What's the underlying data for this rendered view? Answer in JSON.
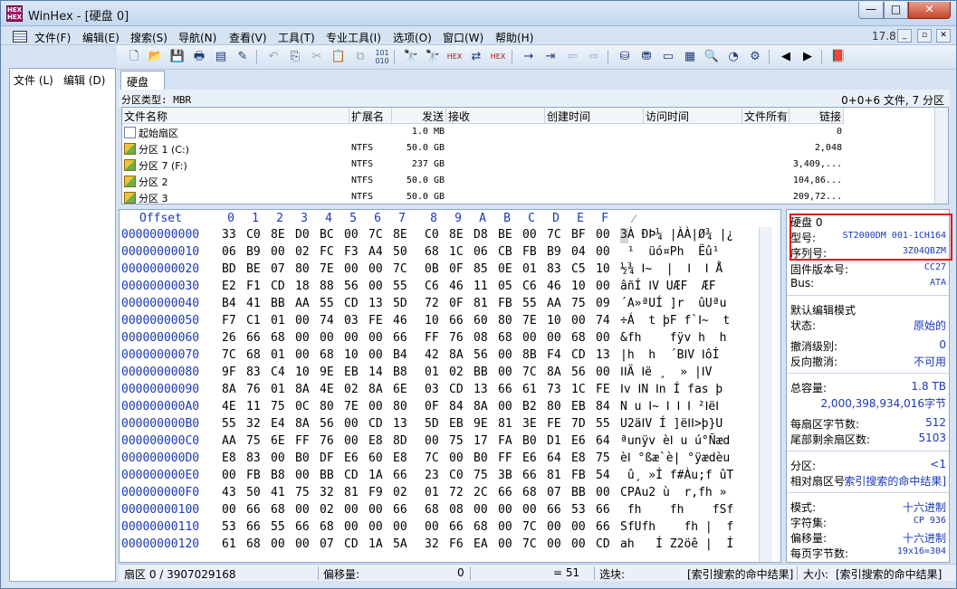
{
  "window": {
    "title": "WinHex - [硬盘 0]",
    "min": "—",
    "max": "□",
    "close": "✕"
  },
  "menu": [
    "文件(F)",
    "编辑(E)",
    "搜索(S)",
    "导航(N)",
    "查看(V)",
    "工具(T)",
    "专业工具(I)",
    "选项(O)",
    "窗口(W)",
    "帮助(H)"
  ],
  "version": "17.8",
  "left_panel": {
    "file": "文件 (L)",
    "edit": "编辑 (D)"
  },
  "tab": "硬盘 0",
  "partition_type": {
    "label": "分区类型: MBR",
    "summary": "0+0+6 文件, 7 分区"
  },
  "file_list": {
    "headers": [
      "文件名称",
      "扩展名",
      "发送",
      "接收",
      "创建时间",
      "访问时间",
      "文件所有",
      "链接"
    ],
    "rows": [
      {
        "name": "起始扇区",
        "ext": "",
        "size": "1.0 MB",
        "link": "0",
        "icon": "document-icon"
      },
      {
        "name": "分区 1 (C:)",
        "ext": "NTFS",
        "size": "50.0 GB",
        "link": "2,048",
        "icon": "partition-icon"
      },
      {
        "name": "分区 7 (F:)",
        "ext": "NTFS",
        "size": "237 GB",
        "link": "3,409,...",
        "icon": "partition-icon"
      },
      {
        "name": "分区 2",
        "ext": "NTFS",
        "size": "50.0 GB",
        "link": "104,86...",
        "icon": "partition-icon"
      },
      {
        "name": "分区 3",
        "ext": "NTFS",
        "size": "50.0 GB",
        "link": "209,72...",
        "icon": "partition-icon"
      }
    ]
  },
  "hex": {
    "offset_label": "Offset",
    "columns": [
      "0",
      "1",
      "2",
      "3",
      "4",
      "5",
      "6",
      "7",
      "8",
      "9",
      "A",
      "B",
      "C",
      "D",
      "E",
      "F"
    ],
    "ascii_header": "⁄",
    "rows": [
      {
        "o": "00000000000",
        "b": [
          "33",
          "C0",
          "8E",
          "D0",
          "BC",
          "00",
          "7C",
          "8E",
          "C0",
          "8E",
          "D8",
          "BE",
          "00",
          "7C",
          "BF",
          "00"
        ],
        "a": "3À ÐÞ¼ |ÀÀ|Ø¾ |¿"
      },
      {
        "o": "00000000010",
        "b": [
          "06",
          "B9",
          "00",
          "02",
          "FC",
          "F3",
          "A4",
          "50",
          "68",
          "1C",
          "06",
          "CB",
          "FB",
          "B9",
          "04",
          "00"
        ],
        "a": " ¹  üó¤Ph  Ëû¹ "
      },
      {
        "o": "00000000020",
        "b": [
          "BD",
          "BE",
          "07",
          "80",
          "7E",
          "00",
          "00",
          "7C",
          "0B",
          "0F",
          "85",
          "0E",
          "01",
          "83",
          "C5",
          "10"
        ],
        "a": "½¾ Ⅰ~  |  Ⅰ  Ⅰ Å"
      },
      {
        "o": "00000000030",
        "b": [
          "E2",
          "F1",
          "CD",
          "18",
          "88",
          "56",
          "00",
          "55",
          "C6",
          "46",
          "11",
          "05",
          "C6",
          "46",
          "10",
          "00"
        ],
        "a": "âñÍ ⅠV UÆF  ÆF "
      },
      {
        "o": "00000000040",
        "b": [
          "B4",
          "41",
          "BB",
          "AA",
          "55",
          "CD",
          "13",
          "5D",
          "72",
          "0F",
          "81",
          "FB",
          "55",
          "AA",
          "75",
          "09"
        ],
        "a": "´A»ªUÍ ]r  ûUªu "
      },
      {
        "o": "00000000050",
        "b": [
          "F7",
          "C1",
          "01",
          "00",
          "74",
          "03",
          "FE",
          "46",
          "10",
          "66",
          "60",
          "80",
          "7E",
          "10",
          "00",
          "74"
        ],
        "a": "÷Á  t þF f`Ⅰ~  t"
      },
      {
        "o": "00000000060",
        "b": [
          "26",
          "66",
          "68",
          "00",
          "00",
          "00",
          "00",
          "66",
          "FF",
          "76",
          "08",
          "68",
          "00",
          "00",
          "68",
          "00"
        ],
        "a": "&fh    fÿv h  h "
      },
      {
        "o": "00000000070",
        "b": [
          "7C",
          "68",
          "01",
          "00",
          "68",
          "10",
          "00",
          "B4",
          "42",
          "8A",
          "56",
          "00",
          "8B",
          "F4",
          "CD",
          "13"
        ],
        "a": "|h  h  ´BⅠV ⅠôÍ "
      },
      {
        "o": "00000000080",
        "b": [
          "9F",
          "83",
          "C4",
          "10",
          "9E",
          "EB",
          "14",
          "B8",
          "01",
          "02",
          "BB",
          "00",
          "7C",
          "8A",
          "56",
          "00"
        ],
        "a": "ⅠⅠÄ Ⅰë ¸  » |ⅠV "
      },
      {
        "o": "00000000090",
        "b": [
          "8A",
          "76",
          "01",
          "8A",
          "4E",
          "02",
          "8A",
          "6E",
          "03",
          "CD",
          "13",
          "66",
          "61",
          "73",
          "1C",
          "FE"
        ],
        "a": "Ⅰv ⅠN Ⅰn Í fas þ"
      },
      {
        "o": "000000000A0",
        "b": [
          "4E",
          "11",
          "75",
          "0C",
          "80",
          "7E",
          "00",
          "80",
          "0F",
          "84",
          "8A",
          "00",
          "B2",
          "80",
          "EB",
          "84"
        ],
        "a": "N u Ⅰ~ Ⅰ Ⅰ Ⅰ ²ⅠëⅠ"
      },
      {
        "o": "000000000B0",
        "b": [
          "55",
          "32",
          "E4",
          "8A",
          "56",
          "00",
          "CD",
          "13",
          "5D",
          "EB",
          "9E",
          "81",
          "3E",
          "FE",
          "7D",
          "55"
        ],
        "a": "U2äⅠV Í ]ëⅠⅠ>þ}U"
      },
      {
        "o": "000000000C0",
        "b": [
          "AA",
          "75",
          "6E",
          "FF",
          "76",
          "00",
          "E8",
          "8D",
          "00",
          "75",
          "17",
          "FA",
          "B0",
          "D1",
          "E6",
          "64"
        ],
        "a": "ªunÿv èⅠ u ú°Ñæd"
      },
      {
        "o": "000000000D0",
        "b": [
          "E8",
          "83",
          "00",
          "B0",
          "DF",
          "E6",
          "60",
          "E8",
          "7C",
          "00",
          "B0",
          "FF",
          "E6",
          "64",
          "E8",
          "75"
        ],
        "a": "èⅠ °ßæ`è| °ÿædèu"
      },
      {
        "o": "000000000E0",
        "b": [
          "00",
          "FB",
          "B8",
          "00",
          "BB",
          "CD",
          "1A",
          "66",
          "23",
          "C0",
          "75",
          "3B",
          "66",
          "81",
          "FB",
          "54"
        ],
        "a": " û¸ »Í f#Àu;f ûT"
      },
      {
        "o": "000000000F0",
        "b": [
          "43",
          "50",
          "41",
          "75",
          "32",
          "81",
          "F9",
          "02",
          "01",
          "72",
          "2C",
          "66",
          "68",
          "07",
          "BB",
          "00"
        ],
        "a": "CPAu2 ù  r,fh » "
      },
      {
        "o": "00000000100",
        "b": [
          "00",
          "66",
          "68",
          "00",
          "02",
          "00",
          "00",
          "66",
          "68",
          "08",
          "00",
          "00",
          "00",
          "66",
          "53",
          "66"
        ],
        "a": " fh    fh    fSf"
      },
      {
        "o": "00000000110",
        "b": [
          "53",
          "66",
          "55",
          "66",
          "68",
          "00",
          "00",
          "00",
          "00",
          "66",
          "68",
          "00",
          "7C",
          "00",
          "00",
          "66"
        ],
        "a": "SfUfh    fh |  f"
      },
      {
        "o": "00000000120",
        "b": [
          "61",
          "68",
          "00",
          "00",
          "07",
          "CD",
          "1A",
          "5A",
          "32",
          "F6",
          "EA",
          "00",
          "7C",
          "00",
          "00",
          "CD"
        ],
        "a": "ah   Í Z2öê |  Í"
      }
    ]
  },
  "info": {
    "disk": "硬盘 0",
    "model_label": "型号:",
    "model": "ST2000DM 001-1CH164",
    "serial_label": "序列号:",
    "serial": "3Z04QBZM",
    "firmware_label": "固件版本号:",
    "firmware": "CC27",
    "bus_label": "Bus:",
    "bus": "ATA",
    "edit_mode": "默认编辑模式",
    "state_label": "状态:",
    "state": "原始的",
    "undo_label": "撤消级别:",
    "undo": "0",
    "redo_label": "反向撤消:",
    "redo": "不可用",
    "capacity_label": "总容量:",
    "capacity": "1.8 TB",
    "bytes": "2,000,398,934,016字节",
    "bps_label": "每扇区字节数:",
    "bps": "512",
    "tail_label": "尾部剩余扇区数:",
    "tail": "5103",
    "partition_label": "分区:",
    "partition": "<1",
    "relsector_label": "相对扇区号",
    "relsector": "索引搜索的命中结果]",
    "mode_label": "模式:",
    "mode": "十六进制",
    "charset_label": "字符集:",
    "charset": "CP 936",
    "offset_label": "偏移量:",
    "offset": "十六进制",
    "bpp_label": "每页字节数:",
    "bpp": "19x16=304"
  },
  "status": {
    "sector": "扇区 0 / 3907029168",
    "offset_label": "偏移量:",
    "offset": "0",
    "eq": "= 51",
    "selection_label": "选块:",
    "selection": "[索引搜索的命中结果]",
    "size_label": "大小:",
    "size": "[索引搜索的命中结果]"
  },
  "colors": {
    "highlight_box": "#e01010",
    "offset_blue": "#1a38b8"
  }
}
